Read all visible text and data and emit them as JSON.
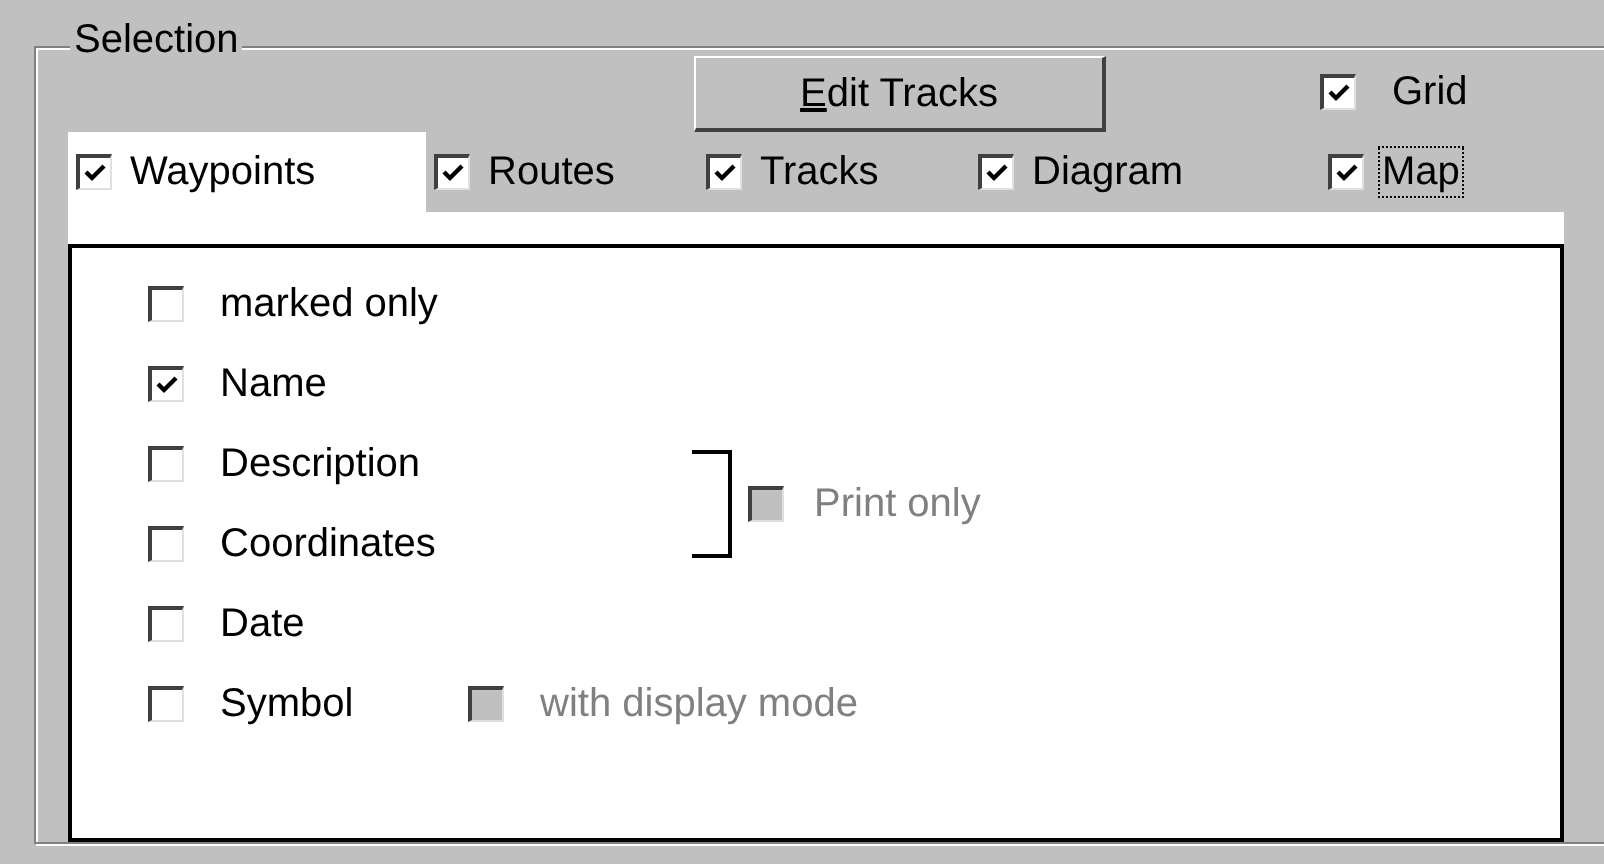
{
  "group_box": {
    "title": "Selection"
  },
  "edit_tracks_button": {
    "label": "Edit Tracks",
    "mnemonic_underlined": true
  },
  "grid_toggle": {
    "label": "Grid",
    "checked": true
  },
  "layer_toggles": [
    {
      "label": "Waypoints",
      "checked": true,
      "selected": true,
      "focused": false
    },
    {
      "label": "Routes",
      "checked": true,
      "selected": false,
      "focused": false
    },
    {
      "label": "Tracks",
      "checked": true,
      "selected": false,
      "focused": false
    },
    {
      "label": "Diagram",
      "checked": true,
      "selected": false,
      "focused": false
    },
    {
      "label": "Map",
      "checked": true,
      "selected": false,
      "focused": true
    }
  ],
  "options": [
    {
      "kind": "checkbox",
      "label": "marked only",
      "checked": false
    },
    {
      "kind": "checkbox",
      "label": "Name",
      "checked": true
    },
    {
      "kind": "group",
      "children": [
        {
          "label": "Description",
          "checked": false
        },
        {
          "label": "Coordinates",
          "checked": false
        }
      ],
      "side_option": {
        "label": "Print only",
        "checked": false,
        "disabled": true
      }
    },
    {
      "kind": "checkbox",
      "label": "Date",
      "checked": false
    },
    {
      "kind": "checkbox",
      "label": "Symbol",
      "checked": false,
      "side_option": {
        "label": "with display mode",
        "checked": false,
        "disabled": true
      }
    }
  ]
}
